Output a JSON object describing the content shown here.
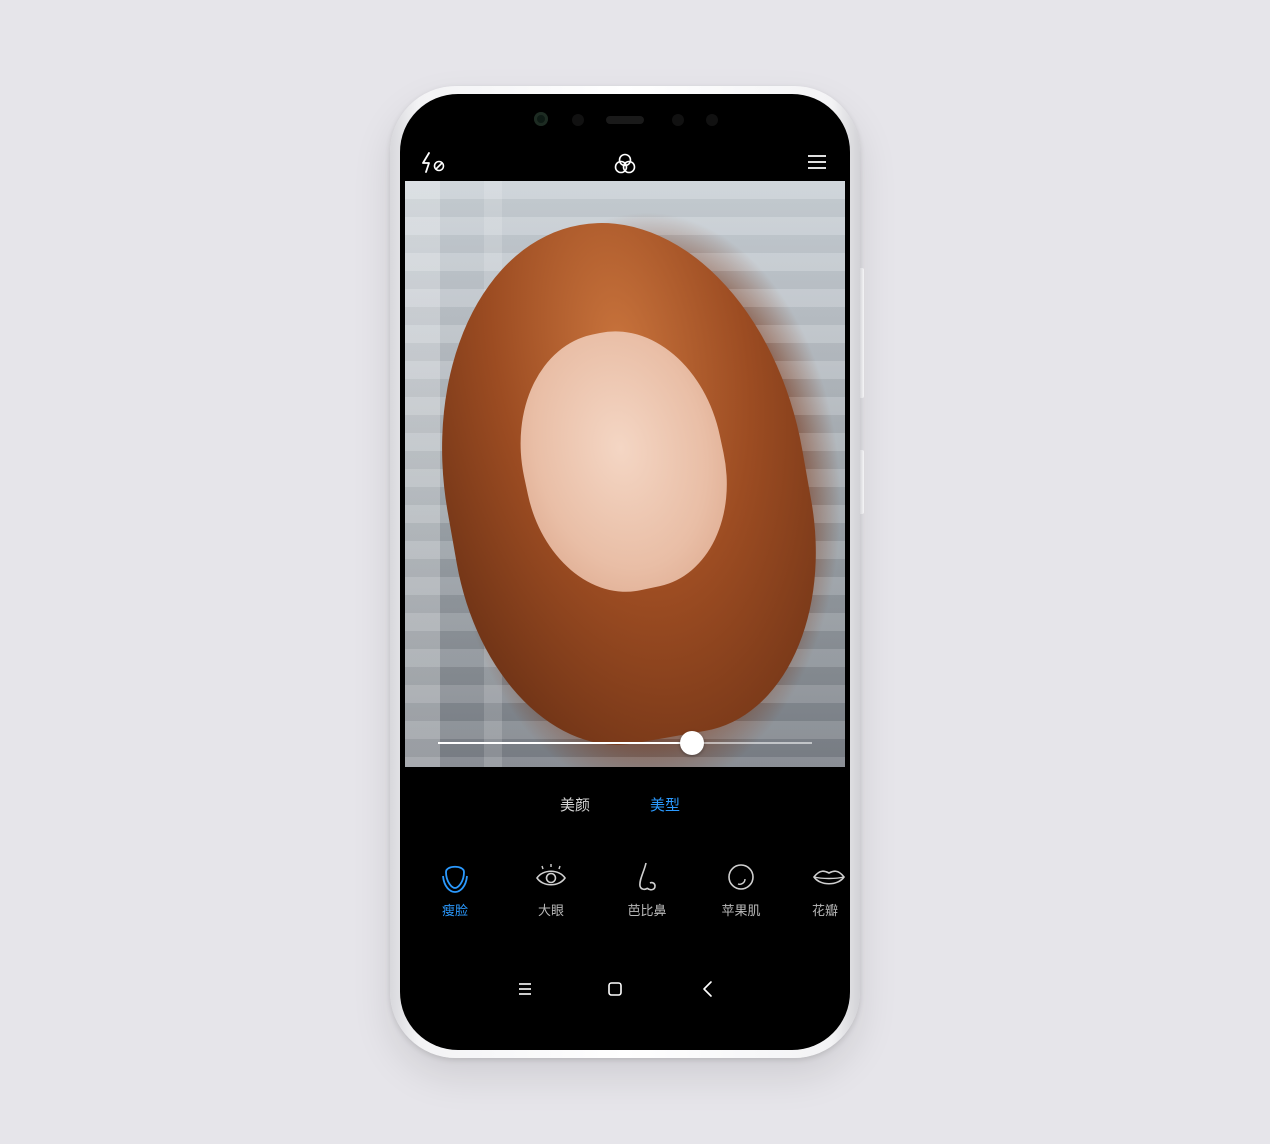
{
  "camera": {
    "mode_tabs": [
      {
        "label": "美颜",
        "active": false
      },
      {
        "label": "美型",
        "active": true
      }
    ],
    "beauty_options": [
      {
        "label": "瘦脸",
        "icon": "face-outline-icon",
        "active": true
      },
      {
        "label": "大眼",
        "icon": "eye-icon",
        "active": false
      },
      {
        "label": "芭比鼻",
        "icon": "nose-icon",
        "active": false
      },
      {
        "label": "苹果肌",
        "icon": "cheek-icon",
        "active": false
      },
      {
        "label": "花瓣",
        "icon": "lips-icon",
        "active": false
      }
    ],
    "slider": {
      "value": 0.68
    },
    "top_icons": {
      "flash": "flash-off-icon",
      "filter": "filter-icon",
      "menu": "menu-icon"
    },
    "nav_icons": [
      "menu-nav-icon",
      "home-icon",
      "back-icon"
    ]
  },
  "colors": {
    "accent": "#2b9aff",
    "background": "#e6e5ea",
    "screen": "#000000"
  }
}
